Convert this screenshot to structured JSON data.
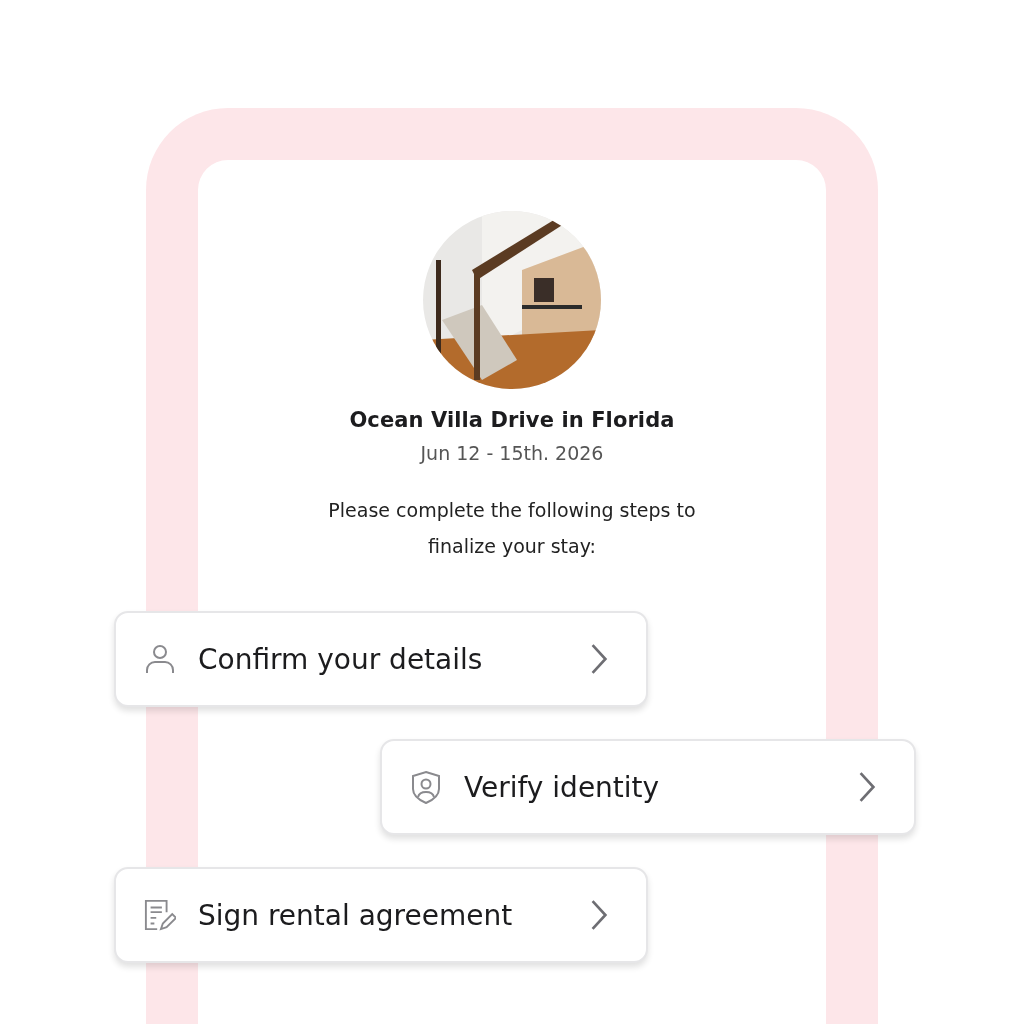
{
  "property": {
    "title": "Ocean Villa Drive in Florida",
    "dates": "Jun 12 - 15th. 2026"
  },
  "instructions": "Please complete the following steps to finalize your stay:",
  "steps": [
    {
      "kind": "person",
      "label": "Confirm your details"
    },
    {
      "kind": "shield",
      "label": "Verify identity"
    },
    {
      "kind": "document",
      "label": "Sign rental agreement"
    }
  ]
}
